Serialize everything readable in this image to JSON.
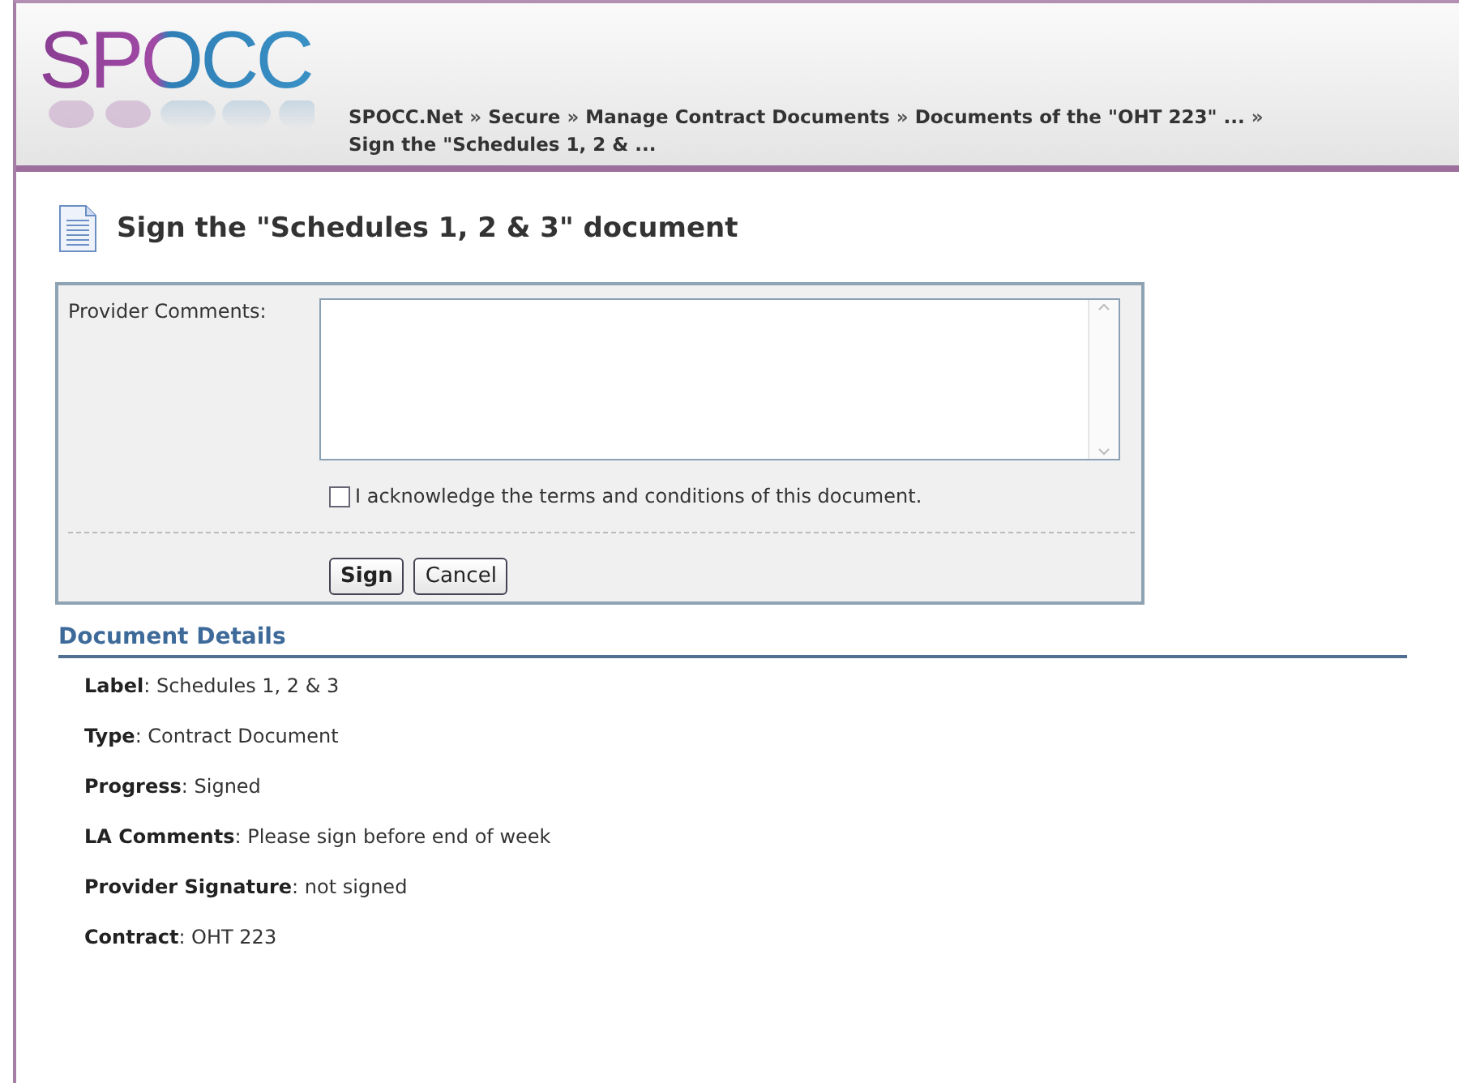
{
  "header": {
    "logo": "SPOCC",
    "separator": "»",
    "breadcrumb": [
      {
        "label": "SPOCC.Net"
      },
      {
        "label": "Secure"
      },
      {
        "label": "Manage Contract Documents"
      },
      {
        "label": "Documents of the \"OHT 223\" ..."
      },
      {
        "label": "Sign the \"Schedules 1, 2 & ..."
      }
    ]
  },
  "page_title": "Sign the \"Schedules 1, 2 & 3\" document",
  "form": {
    "comments_label": "Provider Comments:",
    "acknowledge": {
      "label": "I acknowledge the terms and conditions of this document.",
      "checked": false
    },
    "buttons": [
      "Sign",
      "Cancel"
    ]
  },
  "details": {
    "heading": "Document Details",
    "fields": [
      {
        "text": "**Label**: Schedules 1, 2 & 3"
      },
      {
        "text": "**Type**: Contract Document"
      },
      {
        "text": "**Progress**: Signed"
      },
      {
        "text": "**LA Comments**: Please sign before end of week"
      },
      {
        "text": "**Provider Signature**: not signed"
      },
      {
        "text": "**Contract**: OHT 223"
      }
    ]
  }
}
